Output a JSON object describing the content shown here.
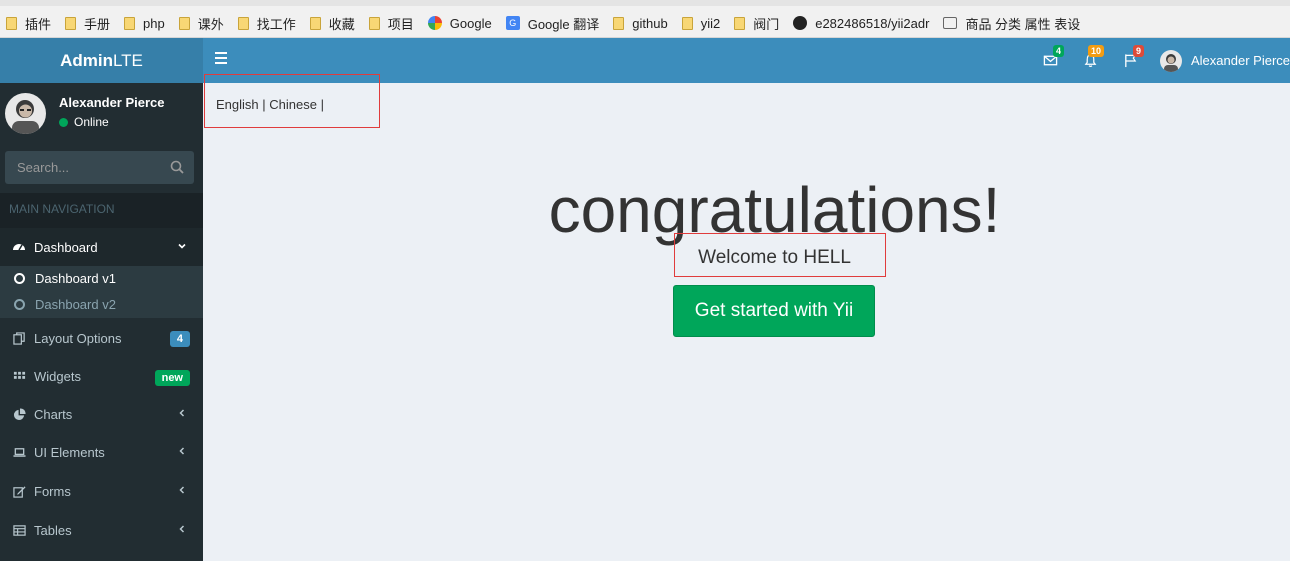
{
  "bookmarks": [
    {
      "label": "插件",
      "icon": "folder-icon"
    },
    {
      "label": "手册",
      "icon": "folder-icon"
    },
    {
      "label": "php",
      "icon": "folder-icon"
    },
    {
      "label": "课外",
      "icon": "folder-icon"
    },
    {
      "label": "找工作",
      "icon": "folder-icon"
    },
    {
      "label": "收藏",
      "icon": "folder-icon"
    },
    {
      "label": "项目",
      "icon": "folder-icon"
    },
    {
      "label": "Google",
      "icon": "google-icon"
    },
    {
      "label": "Google 翻译",
      "icon": "google-translate-icon"
    },
    {
      "label": "github",
      "icon": "folder-icon"
    },
    {
      "label": "yii2",
      "icon": "folder-icon"
    },
    {
      "label": "阀门",
      "icon": "folder-icon"
    },
    {
      "label": "e282486518/yii2adr",
      "icon": "github-icon"
    },
    {
      "label": "商品 分类 属性 表设",
      "icon": "page-icon"
    }
  ],
  "header": {
    "logo_bold": "Admin",
    "logo_rest": "LTE",
    "messages_count": "4",
    "notifications_count": "10",
    "tasks_count": "9",
    "user_name": "Alexander Pierce",
    "colors": {
      "header": "#3c8dbc",
      "logo": "#367fa9",
      "green": "#00a65a",
      "yellow": "#f39c12",
      "red": "#dd4b39"
    }
  },
  "sidebar": {
    "user_name": "Alexander Pierce",
    "status": "Online",
    "search_placeholder": "Search...",
    "section_header": "MAIN NAVIGATION",
    "dashboard": "Dashboard",
    "sub_items": [
      "Dashboard v1",
      "Dashboard v2"
    ],
    "items": [
      {
        "label": "Layout Options",
        "icon": "files-icon",
        "badge": "4"
      },
      {
        "label": "Widgets",
        "icon": "grid-icon",
        "badge": "new"
      },
      {
        "label": "Charts",
        "icon": "pie-chart-icon"
      },
      {
        "label": "UI Elements",
        "icon": "laptop-icon"
      },
      {
        "label": "Forms",
        "icon": "edit-icon"
      },
      {
        "label": "Tables",
        "icon": "table-icon"
      }
    ]
  },
  "content": {
    "lang_english": "English",
    "lang_chinese": "Chinese",
    "lang_sep": "|",
    "title": "congratulations!",
    "welcome": "Welcome to HELL",
    "cta": "Get started with Yii"
  }
}
